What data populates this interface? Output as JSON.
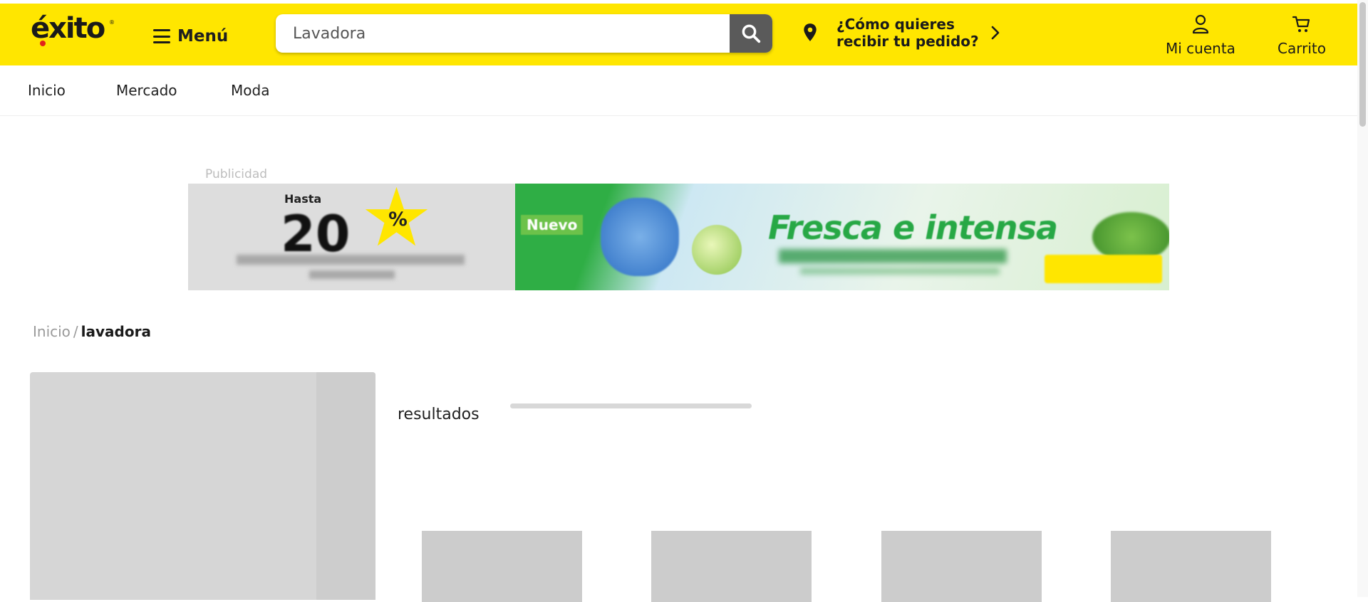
{
  "header": {
    "logo": "éxito",
    "logo_reg": "®",
    "menu_label": "Menú",
    "search": {
      "value": "Lavadora",
      "placeholder": "Lavadora"
    },
    "delivery": {
      "line1": "¿Cómo quieres",
      "line2": "recibir tu pedido?"
    },
    "account_label": "Mi cuenta",
    "cart_label": "Carrito",
    "colors": {
      "brand_yellow": "#ffe600",
      "search_button": "#5a5a5a",
      "logo_dot": "#e2231a"
    },
    "icons": [
      "menu-icon",
      "search-icon",
      "location-pin-icon",
      "chevron-right-icon",
      "user-icon",
      "cart-icon"
    ]
  },
  "nav": {
    "items": [
      "Inicio",
      "Mercado",
      "Moda"
    ]
  },
  "ad": {
    "label": "Publicidad",
    "banner": {
      "hasta": "Hasta",
      "discount": "20",
      "percent": "%",
      "tag": "Nuevo",
      "headline": "Fresca e intensa"
    }
  },
  "breadcrumb": {
    "home": "Inicio",
    "separator": "/",
    "current": "lavadora"
  },
  "results": {
    "label": "resultados"
  }
}
